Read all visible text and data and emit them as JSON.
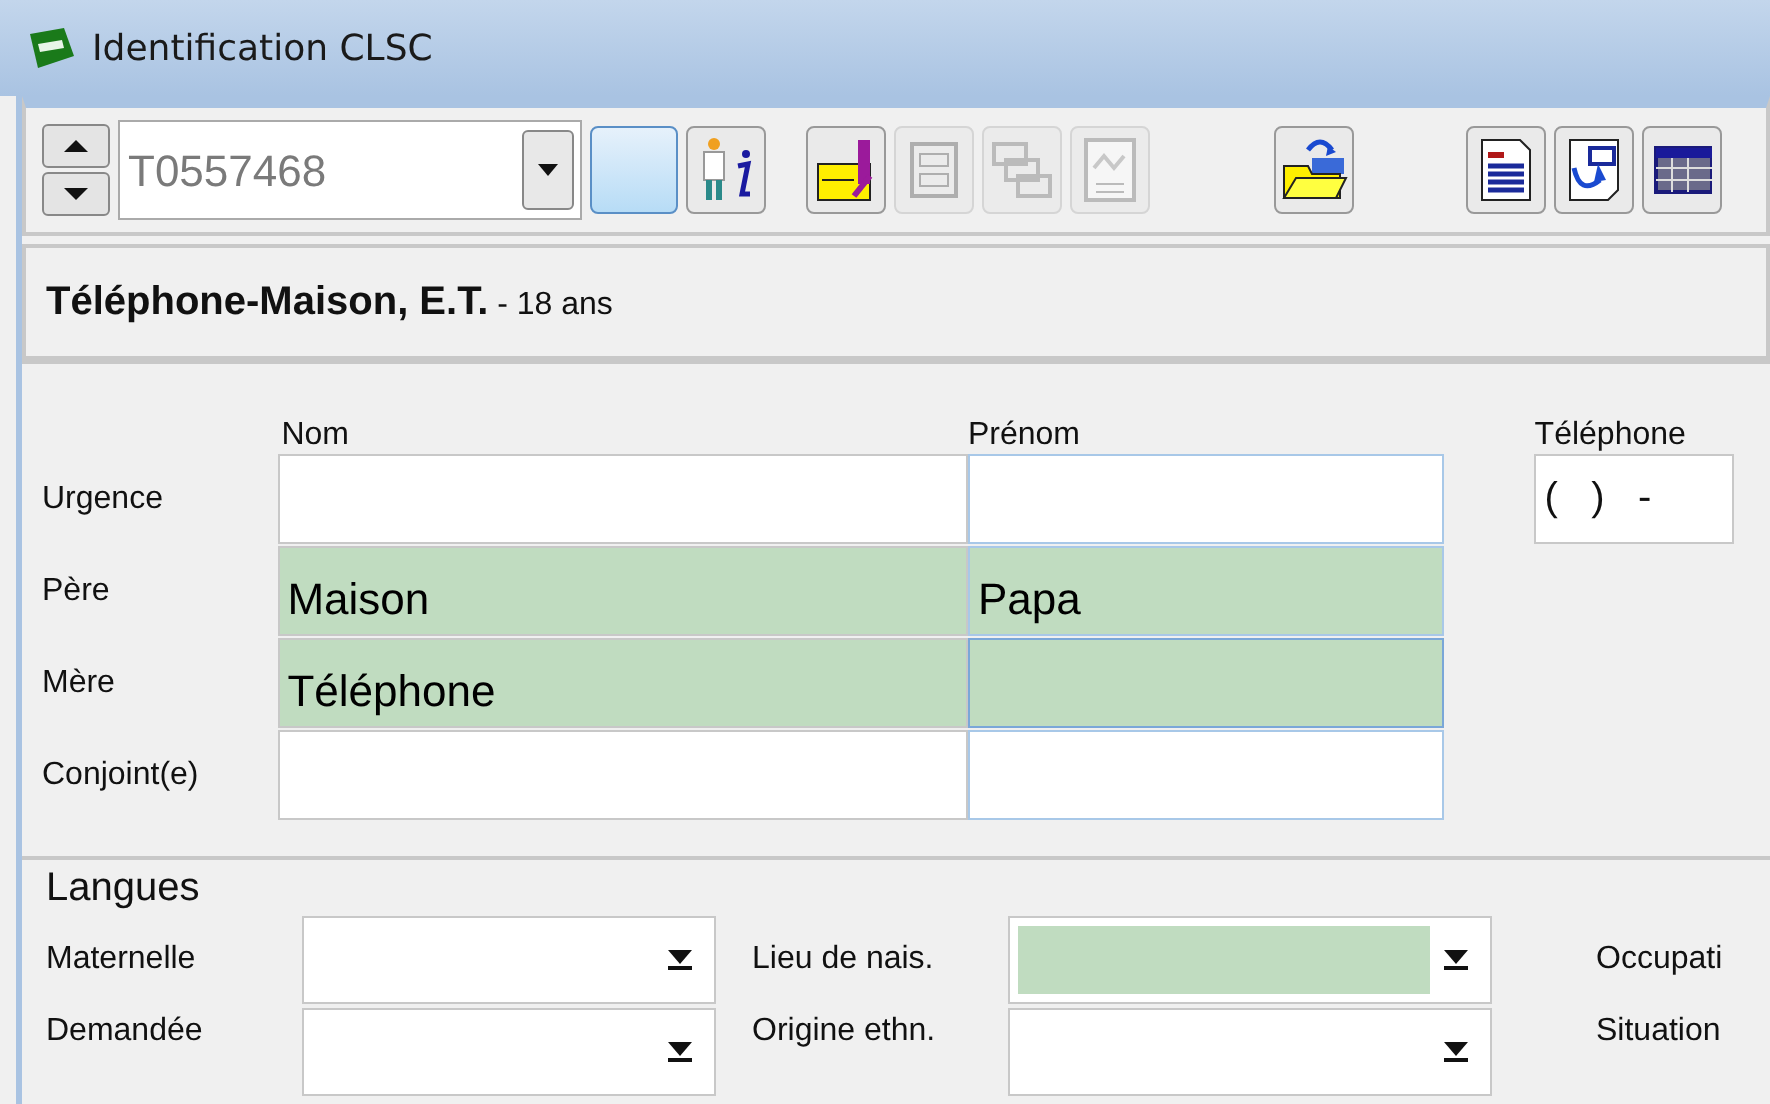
{
  "window": {
    "title": "Identification CLSC"
  },
  "toolbar": {
    "record": {
      "value": "T0557468"
    },
    "buttons": [
      {
        "kind": "blank",
        "disabled": false
      },
      {
        "kind": "person-info",
        "disabled": false
      },
      {
        "kind": "folder-key",
        "disabled": false
      },
      {
        "kind": "cabinet",
        "disabled": true
      },
      {
        "kind": "folders",
        "disabled": true
      },
      {
        "kind": "chart-doc",
        "disabled": true
      },
      {
        "kind": "open-folder",
        "disabled": false
      },
      {
        "kind": "report",
        "disabled": false
      },
      {
        "kind": "export",
        "disabled": false
      },
      {
        "kind": "table",
        "disabled": false
      }
    ]
  },
  "patient": {
    "name": "Téléphone-Maison, E.T.",
    "age": "- 18 ans"
  },
  "contacts": {
    "columns": [
      "Nom",
      "Prénom"
    ],
    "rows": [
      {
        "label": "Urgence",
        "cells": [
          {
            "highlighted": false,
            "focused": false
          },
          {
            "highlighted": false,
            "focused": false
          }
        ]
      },
      {
        "label": "Père",
        "cells": [
          {
            "value": "Maison",
            "highlighted": true,
            "focused": false
          },
          {
            "value": "Papa",
            "highlighted": true,
            "focused": false
          }
        ]
      },
      {
        "label": "Mère",
        "cells": [
          {
            "value": "Téléphone",
            "highlighted": true,
            "focused": false
          },
          {
            "highlighted": true,
            "focused": true
          }
        ]
      },
      {
        "label": "Conjoint(e)",
        "cells": [
          {
            "highlighted": false,
            "focused": false
          },
          {
            "highlighted": false,
            "focused": false
          }
        ]
      }
    ]
  },
  "phone": {
    "label": "Téléphone",
    "value": "(   )   -"
  },
  "langues": {
    "title": "Langues",
    "rows": [
      [
        {
          "label": "Maternelle",
          "highlighted": false
        },
        {
          "label": "Lieu de nais.",
          "highlighted": true
        },
        {
          "label": "Occupati"
        }
      ],
      [
        {
          "label": "Demandée",
          "highlighted": false
        },
        {
          "label": "Origine ethn.",
          "highlighted": false
        },
        {
          "label": "Situation"
        }
      ]
    ]
  }
}
